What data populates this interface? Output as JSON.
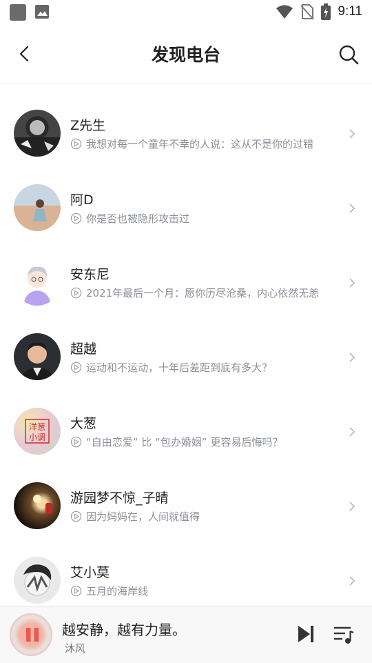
{
  "status_bar": {
    "time": "9:11",
    "icons": [
      "app-square-icon",
      "gallery-icon",
      "wifi-icon",
      "no-sim-icon",
      "battery-charging-icon"
    ]
  },
  "header": {
    "title": "发现电台",
    "back_icon": "back-arrow-icon",
    "search_icon": "search-icon"
  },
  "stations": [
    {
      "name": "Z先生",
      "desc": "我想对每一个童年不幸的人说：这从不是你的过错"
    },
    {
      "name": "阿D",
      "desc": "你是否也被隐形攻击过"
    },
    {
      "name": "安东尼",
      "desc": "2021年最后一个月：愿你历尽沧桑，内心依然无恙"
    },
    {
      "name": "超越",
      "desc": "运动和不运动，十年后差距到底有多大？"
    },
    {
      "name": "大葱",
      "desc": "“自由恋爱” 比 “包办婚姻” 更容易后悔吗？",
      "avatar_text": "洋葱小调"
    },
    {
      "name": "游园梦不惊_子晴",
      "desc": "因为妈妈在，人间就值得"
    },
    {
      "name": "艾小莫",
      "desc": "五月的海岸线"
    }
  ],
  "player": {
    "song": "越安静，越有力量。",
    "artist": "沐风",
    "controls": [
      "pause-icon",
      "next-icon",
      "playlist-icon"
    ]
  },
  "colors": {
    "text_primary": "#222222",
    "text_secondary": "#8a8f99",
    "pause_accent": "#e85a4f",
    "player_bg": "#f8f8f8"
  }
}
